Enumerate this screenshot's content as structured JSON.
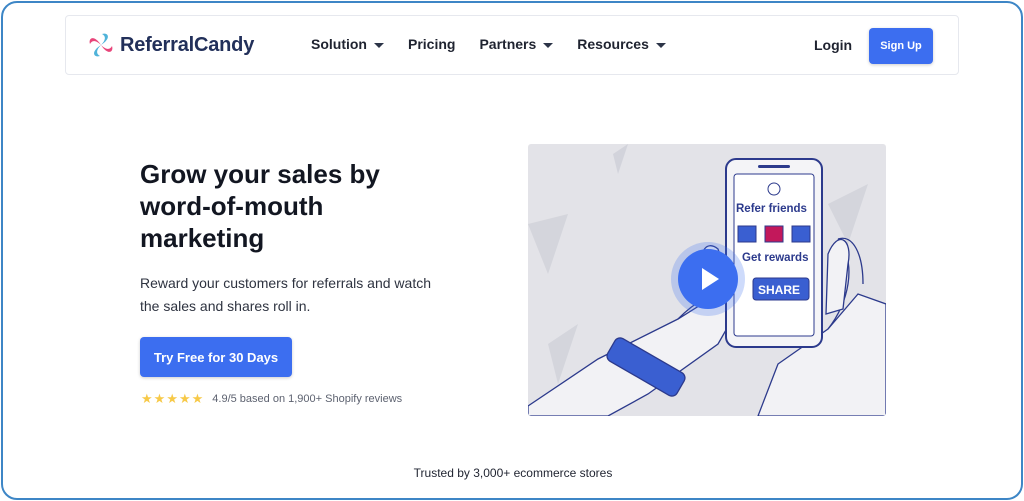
{
  "brand": {
    "name": "ReferralCandy"
  },
  "nav": {
    "items": [
      {
        "label": "Solution",
        "dropdown": true
      },
      {
        "label": "Pricing",
        "dropdown": false
      },
      {
        "label": "Partners",
        "dropdown": true
      },
      {
        "label": "Resources",
        "dropdown": true
      }
    ],
    "login": "Login",
    "signup": "Sign Up"
  },
  "hero": {
    "headline": "Grow your sales by word-of-mouth marketing",
    "subtext": "Reward your customers for referrals and watch the sales and shares roll in.",
    "cta": "Try Free for 30 Days",
    "rating": {
      "stars": 5,
      "text": "4.9/5 based on 1,900+ Shopify reviews"
    }
  },
  "video": {
    "refer_text": "Refer friends",
    "reward_text": "Get rewards",
    "share_text": "SHARE"
  },
  "footer": {
    "trusted": "Trusted by 3,000+ ecommerce stores"
  },
  "colors": {
    "accent": "#3c6ef0",
    "brand_dark": "#22305a",
    "frame": "#3d86c6",
    "star": "#f7c948"
  }
}
